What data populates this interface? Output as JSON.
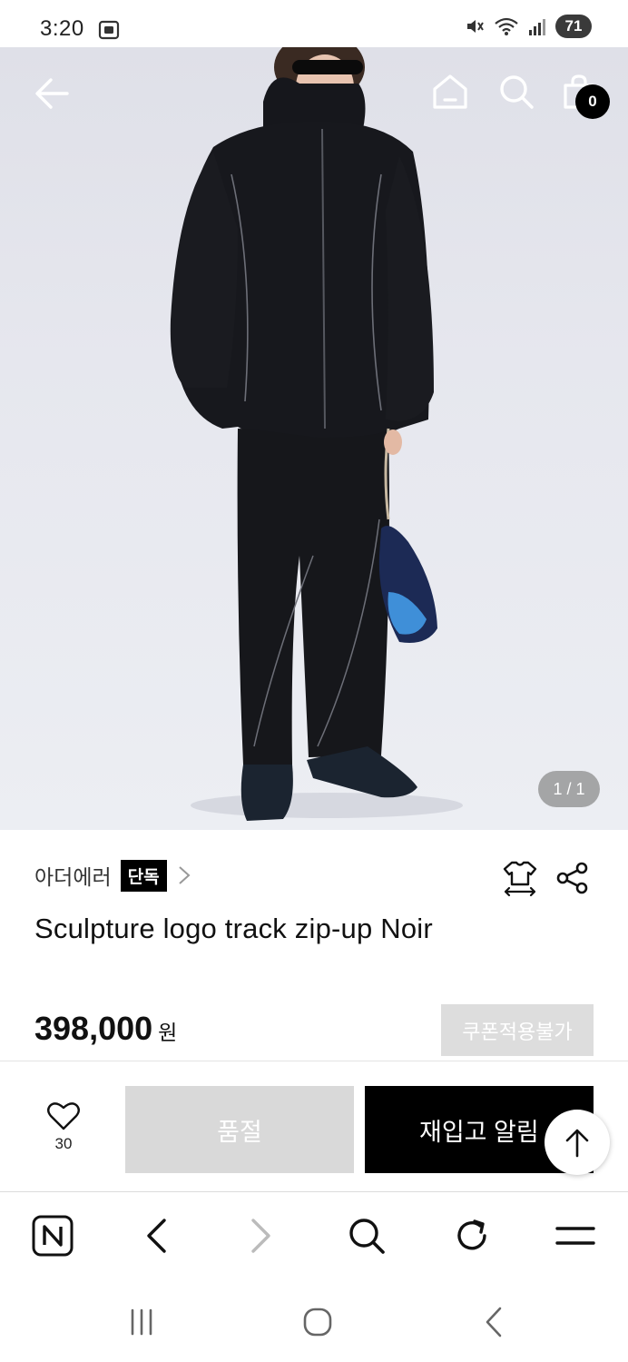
{
  "status_bar": {
    "time": "3:20",
    "battery": "71"
  },
  "hero": {
    "image_counter": "1 / 1",
    "cart_count": "0"
  },
  "product": {
    "brand": "아더에러",
    "badge": "단독",
    "title": "Sculpture logo track zip-up Noir",
    "price": "398,000",
    "currency": "원",
    "coupon_label": "쿠폰적용불가"
  },
  "actions": {
    "wish_count": "30",
    "soldout_label": "품절",
    "restock_label": "재입고 알림"
  },
  "colors": {
    "accent": "#000000",
    "disabled_button": "#d9d9d9",
    "coupon_disabled": "#dddddd"
  },
  "icons": {
    "hero": [
      "back-arrow-icon",
      "home-icon",
      "search-icon",
      "shopping-bag-icon"
    ],
    "product": [
      "chevron-right-icon",
      "size-fit-icon",
      "share-icon"
    ],
    "actions": [
      "heart-icon",
      "arrow-up-icon"
    ],
    "browser": [
      "naver-n-icon",
      "back-icon",
      "forward-icon",
      "search-icon",
      "refresh-icon",
      "menu-icon"
    ],
    "system": [
      "recents-icon",
      "home-icon",
      "back-icon"
    ]
  }
}
